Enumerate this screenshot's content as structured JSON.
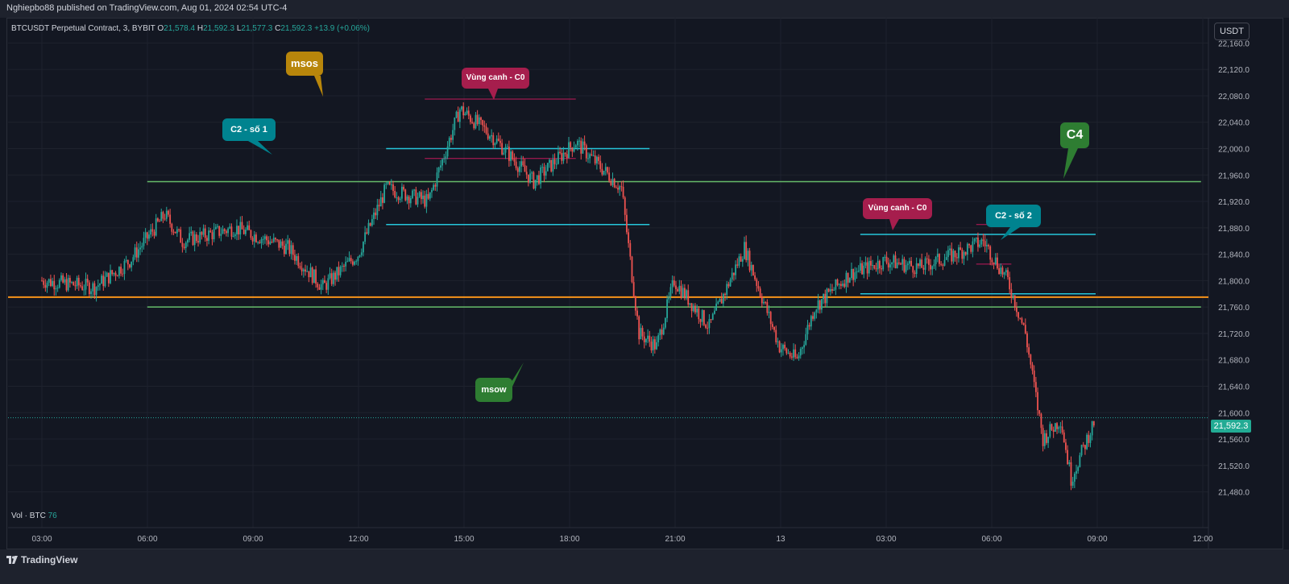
{
  "header": {
    "publish_line": "Nghiepbo88 published on TradingView.com, Aug 01, 2024 02:54 UTC-4"
  },
  "legend": {
    "symbol": "BTCUSDT Perpetual Contract, 3, BYBIT",
    "o_label": "O",
    "o_value": "21,578.4",
    "h_label": "H",
    "h_value": "21,592.3",
    "l_label": "L",
    "l_value": "21,577.3",
    "c_label": "C",
    "c_value": "21,592.3",
    "change": "+13.9 (+0.06%)"
  },
  "volume": {
    "label": "Vol · BTC",
    "value": "76"
  },
  "currency_button": "USDT",
  "last_price": "21,592.3",
  "footer": {
    "brand": "TradingView"
  },
  "colors": {
    "up": "#26a69a",
    "down": "#ef5350",
    "cyan": "#26c6da",
    "orange": "#f7931a",
    "green_line": "#66bb6a",
    "magenta": "#c2185b"
  },
  "annotations": [
    {
      "text": "msos",
      "color": "#b8860b"
    },
    {
      "text": "Vùng canh - C0",
      "color": "#a61e4d"
    },
    {
      "text": "C2 - số 1",
      "color": "#00838f"
    },
    {
      "text": "C4",
      "color": "#2e7d32"
    },
    {
      "text": "Vùng canh - C0",
      "color": "#a61e4d"
    },
    {
      "text": "C2 - số 2",
      "color": "#00838f"
    },
    {
      "text": "msow",
      "color": "#2e7d32"
    }
  ],
  "chart_data": {
    "type": "candlestick",
    "symbol": "BTCUSDT Perpetual Contract, 3, BYBIT",
    "y_axis": {
      "ylim": [
        21460,
        22180
      ],
      "ticks": [
        "22,160.0",
        "22,120.0",
        "22,080.0",
        "22,040.0",
        "22,000.0",
        "21,960.0",
        "21,920.0",
        "21,880.0",
        "21,840.0",
        "21,800.0",
        "21,760.0",
        "21,720.0",
        "21,680.0",
        "21,640.0",
        "21,600.0",
        "21,560.0",
        "21,520.0",
        "21,480.0"
      ]
    },
    "x_axis": {
      "ticks": [
        "03:00",
        "06:00",
        "09:00",
        "12:00",
        "15:00",
        "18:00",
        "21:00",
        "13",
        "03:00",
        "06:00",
        "09:00",
        "12:00"
      ]
    },
    "grid": true,
    "price_path": [
      {
        "t": 0.0,
        "p": 21800
      },
      {
        "t": 1.5,
        "p": 21790
      },
      {
        "t": 2.5,
        "p": 21830
      },
      {
        "t": 3.5,
        "p": 21900
      },
      {
        "t": 4.0,
        "p": 21860
      },
      {
        "t": 5.5,
        "p": 21880
      },
      {
        "t": 7.0,
        "p": 21850
      },
      {
        "t": 8.0,
        "p": 21790
      },
      {
        "t": 9.0,
        "p": 21840
      },
      {
        "t": 9.8,
        "p": 21940
      },
      {
        "t": 11.0,
        "p": 21920
      },
      {
        "t": 11.9,
        "p": 22060
      },
      {
        "t": 12.8,
        "p": 22020
      },
      {
        "t": 14.0,
        "p": 21950
      },
      {
        "t": 15.2,
        "p": 22010
      },
      {
        "t": 16.5,
        "p": 21940
      },
      {
        "t": 17.0,
        "p": 21720
      },
      {
        "t": 17.5,
        "p": 21700
      },
      {
        "t": 18.0,
        "p": 21800
      },
      {
        "t": 19.0,
        "p": 21730
      },
      {
        "t": 20.0,
        "p": 21850
      },
      {
        "t": 21.0,
        "p": 21700
      },
      {
        "t": 21.5,
        "p": 21680
      },
      {
        "t": 22.0,
        "p": 21760
      },
      {
        "t": 23.0,
        "p": 21810
      },
      {
        "t": 24.0,
        "p": 21830
      },
      {
        "t": 25.0,
        "p": 21820
      },
      {
        "t": 26.0,
        "p": 21840
      },
      {
        "t": 26.8,
        "p": 21860
      },
      {
        "t": 27.5,
        "p": 21800
      },
      {
        "t": 28.0,
        "p": 21720
      },
      {
        "t": 28.5,
        "p": 21560
      },
      {
        "t": 29.0,
        "p": 21590
      },
      {
        "t": 29.3,
        "p": 21500
      },
      {
        "t": 30.0,
        "p": 21592.3
      }
    ],
    "horizontal_lines": [
      {
        "label": "orange",
        "price": 21775,
        "t_start": -1,
        "t_end": 40
      },
      {
        "label": "green-upper",
        "price": 21950,
        "t_start": 3,
        "t_end": 33
      },
      {
        "label": "green-lower",
        "price": 21760,
        "t_start": 3,
        "t_end": 33
      },
      {
        "label": "cyan-1-top",
        "price": 22000,
        "t_start": 9.8,
        "t_end": 17.3
      },
      {
        "label": "cyan-1-bottom",
        "price": 21885,
        "t_start": 9.8,
        "t_end": 17.3
      },
      {
        "label": "cyan-2-top",
        "price": 21870,
        "t_start": 23.3,
        "t_end": 30
      },
      {
        "label": "cyan-2-bottom",
        "price": 21780,
        "t_start": 23.3,
        "t_end": 30
      },
      {
        "label": "magenta-1-top",
        "price": 22075,
        "t_start": 10.9,
        "t_end": 15.2
      },
      {
        "label": "magenta-1-bottom",
        "price": 21985,
        "t_start": 10.9,
        "t_end": 15.2
      },
      {
        "label": "magenta-2-top",
        "price": 21885,
        "t_start": 26.6,
        "t_end": 27.6
      },
      {
        "label": "magenta-2-bottom",
        "price": 21825,
        "t_start": 26.6,
        "t_end": 27.6
      }
    ]
  }
}
